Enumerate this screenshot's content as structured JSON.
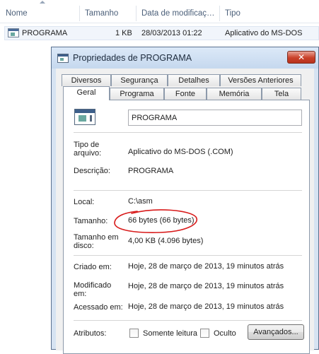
{
  "explorer": {
    "columns": {
      "name": "Nome",
      "size": "Tamanho",
      "date_modified": "Data de modificaç…",
      "type": "Tipo"
    },
    "file": {
      "icon": "msdos-application-icon",
      "name": "PROGRAMA",
      "size": "1 KB",
      "date_modified": "28/03/2013 01:22",
      "type": "Aplicativo do MS-DOS"
    }
  },
  "dialog": {
    "title": "Propriedades de PROGRAMA",
    "close_label": "✕",
    "tabs_back": [
      "Diversos",
      "Segurança",
      "Detalhes",
      "Versões Anteriores"
    ],
    "tabs_front": [
      "Geral",
      "Programa",
      "Fonte",
      "Memória",
      "Tela"
    ],
    "active_tab": "Geral",
    "file_name": "PROGRAMA",
    "fields": {
      "type_label": "Tipo de arquivo:",
      "type_value": "Aplicativo do MS-DOS (.COM)",
      "description_label": "Descrição:",
      "description_value": "PROGRAMA",
      "location_label": "Local:",
      "location_value": "C:\\asm",
      "size_label": "Tamanho:",
      "size_value": "66 bytes (66 bytes)",
      "size_on_disk_label": "Tamanho em disco:",
      "size_on_disk_value": "4,00 KB (4.096 bytes)",
      "created_label": "Criado em:",
      "created_value": "Hoje, 28 de março de 2013, 19 minutos atrás",
      "modified_label": "Modificado em:",
      "modified_value": "Hoje, 28 de março de 2013, 19 minutos atrás",
      "accessed_label": "Acessado em:",
      "accessed_value": "Hoje, 28 de março de 2013, 19 minutos atrás",
      "attributes_label": "Atributos:"
    },
    "attributes": {
      "read_only_label": "Somente leitura",
      "read_only_checked": false,
      "hidden_label": "Oculto",
      "hidden_checked": false,
      "advanced_button": "Avançados..."
    },
    "annotation_color": "#d81b1b"
  },
  "colors": {
    "dialog_frame": "#d6e3f2",
    "close_button": "#c9412a",
    "header_text": "#4c607a"
  }
}
